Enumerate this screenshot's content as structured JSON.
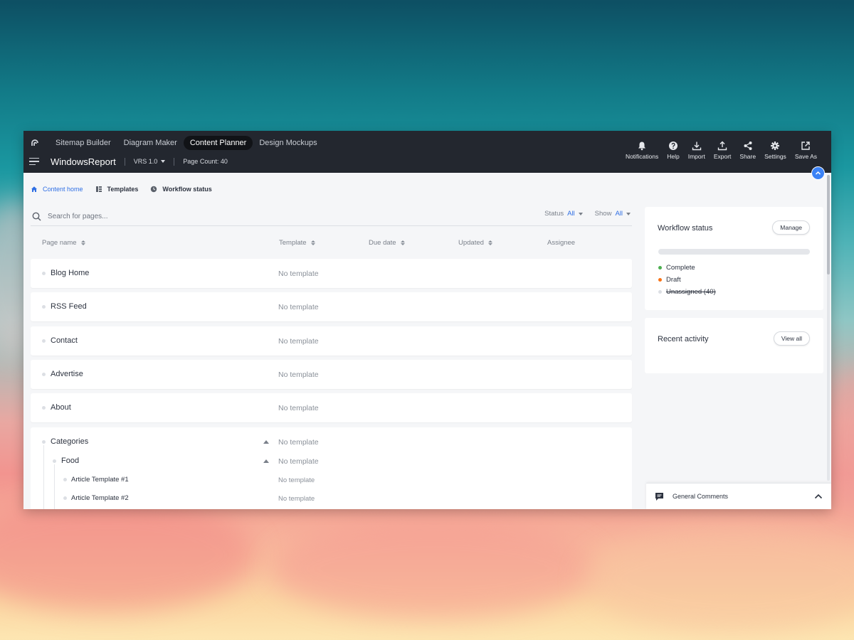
{
  "app": {
    "tabs": [
      {
        "label": "Sitemap Builder"
      },
      {
        "label": "Diagram Maker"
      },
      {
        "label": "Content Planner",
        "active": true
      },
      {
        "label": "Design Mockups"
      }
    ],
    "project_name": "WindowsReport",
    "version": "VRS 1.0",
    "page_count": "Page Count: 40"
  },
  "toolbar": [
    {
      "label": "Notifications",
      "icon": "bell-icon"
    },
    {
      "label": "Help",
      "icon": "help-icon"
    },
    {
      "label": "Import",
      "icon": "import-icon"
    },
    {
      "label": "Export",
      "icon": "export-icon"
    },
    {
      "label": "Share",
      "icon": "share-icon"
    },
    {
      "label": "Settings",
      "icon": "gear-icon"
    },
    {
      "label": "Save As",
      "icon": "external-link-icon"
    }
  ],
  "breadcrumbs": [
    {
      "label": "Content home",
      "icon": "home-icon",
      "active": true
    },
    {
      "label": "Templates",
      "icon": "templates-icon"
    },
    {
      "label": "Workflow status",
      "icon": "clock-icon"
    }
  ],
  "search": {
    "placeholder": "Search for pages..."
  },
  "filters": {
    "status_label": "Status",
    "status_value": "All",
    "show_label": "Show",
    "show_value": "All"
  },
  "columns": {
    "page_name": "Page name",
    "template": "Template",
    "due_date": "Due date",
    "updated": "Updated",
    "assignee": "Assignee"
  },
  "pages": [
    {
      "name": "Blog Home",
      "template": "No template"
    },
    {
      "name": "RSS Feed",
      "template": "No template"
    },
    {
      "name": "Contact",
      "template": "No template"
    },
    {
      "name": "Advertise",
      "template": "No template"
    },
    {
      "name": "About",
      "template": "No template"
    }
  ],
  "categories": {
    "name": "Categories",
    "template": "No template",
    "child": {
      "name": "Food",
      "template": "No template",
      "children": [
        {
          "name": "Article Template #1",
          "template": "No template"
        },
        {
          "name": "Article Template #2",
          "template": "No template"
        }
      ]
    }
  },
  "workflow": {
    "title": "Workflow status",
    "manage_label": "Manage",
    "legend": [
      {
        "label": "Complete",
        "color": "#4caf50"
      },
      {
        "label": "Draft",
        "color": "#f97316"
      },
      {
        "label": "Unassigned (40)",
        "color": "#dcdfe4"
      }
    ]
  },
  "activity": {
    "title": "Recent activity",
    "view_all_label": "View all"
  },
  "comments": {
    "label": "General Comments"
  },
  "colors": {
    "accent": "#2f6fe4",
    "topbar": "#23272f"
  }
}
